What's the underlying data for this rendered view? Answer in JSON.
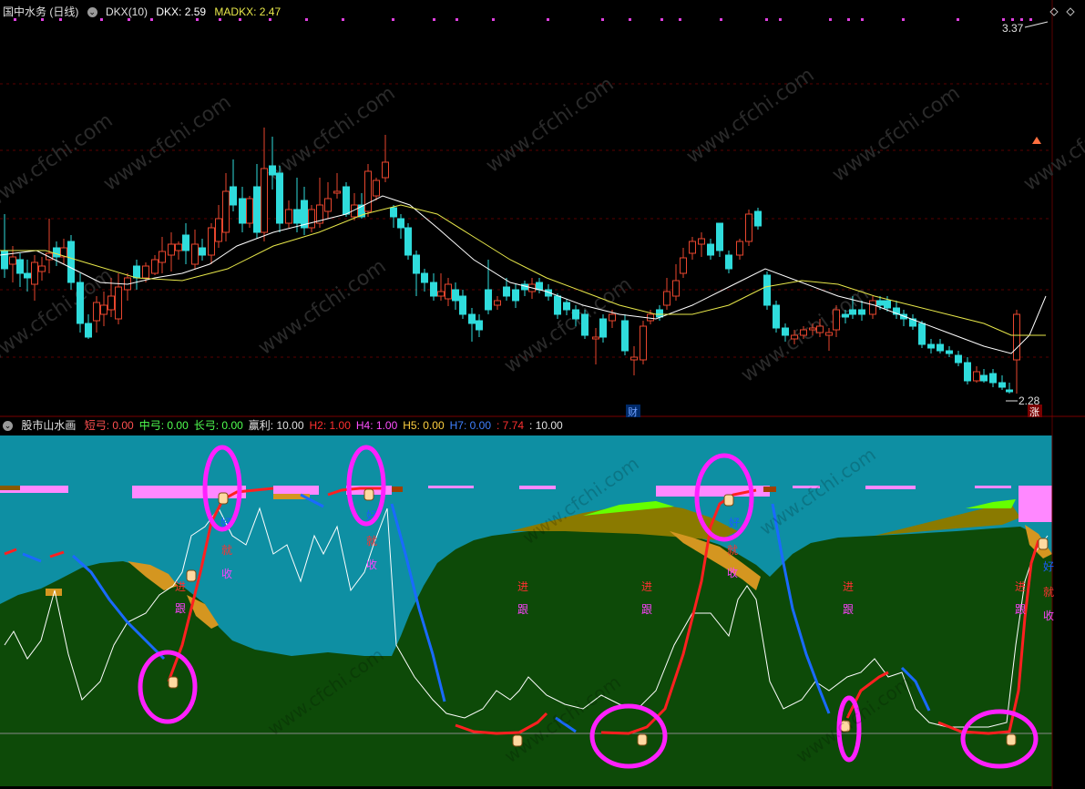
{
  "top_chart": {
    "stock_title": "国中水务 (日线)",
    "indicator_name": "DKX(10)",
    "dkx_label": "DKX: 2.59",
    "madkx_label": "MADKX: 2.47",
    "high_price_label": "3.37",
    "low_price_label": "2.28",
    "finance_marker": "财",
    "limit_up_marker": "涨",
    "colors": {
      "dkx": "#ffffff",
      "madkx": "#e8e84a",
      "up": "#e8462e",
      "down": "#2fdcdc"
    }
  },
  "bottom_chart": {
    "indicator_title": "股市山水画",
    "legend": [
      {
        "label": "短弓: 0.00",
        "color": "#ff5050"
      },
      {
        "label": "中弓: 0.00",
        "color": "#50ff50"
      },
      {
        "label": "长弓: 0.00",
        "color": "#50ff50"
      },
      {
        "label": "赢利: 10.00",
        "color": "#e0e0e0"
      },
      {
        "label": "H2: 1.00",
        "color": "#ff3030"
      },
      {
        "label": "H4: 1.00",
        "color": "#ff50ff"
      },
      {
        "label": "H5: 0.00",
        "color": "#ffd040"
      },
      {
        "label": "H7: 0.00",
        "color": "#4080ff"
      },
      {
        "label": ": 7.74",
        "color": "#ff3030"
      },
      {
        "label": ": 10.00",
        "color": "#e0e0e0"
      }
    ],
    "signals": [
      {
        "text": "好",
        "color": "#1a5cff"
      },
      {
        "text": "就",
        "color": "#ff3030"
      },
      {
        "text": "收",
        "color": "#ff40ff"
      },
      {
        "text": "进",
        "color": "#ff3030"
      },
      {
        "text": "跟",
        "color": "#ff40ff"
      }
    ],
    "colors": {
      "sky": "#0e8fa3",
      "land": "#0d4a08",
      "sand": "#d49620",
      "pink": "#ff88ff",
      "bright_green": "#66ff00",
      "olive": "#8a7a00"
    }
  },
  "watermark": "www.cfchi.com"
}
